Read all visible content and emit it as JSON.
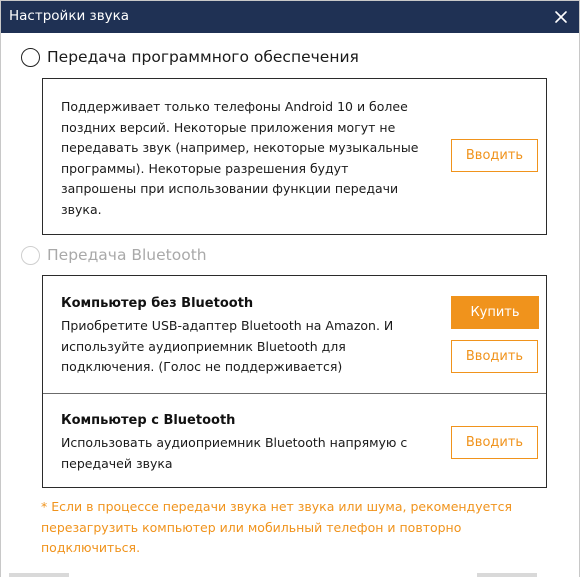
{
  "window": {
    "title": "Настройки звука",
    "close_icon": "close-icon"
  },
  "software_transfer": {
    "label": "Передача программного обеспечения",
    "selected": false,
    "description": "Поддерживает только телефоны Android 10 и более поздних версий. Некоторые приложения могут не передавать звук (например, некоторые музыкальные программы). Некоторые разрешения будут запрошены при использовании функции передачи звука.",
    "enter_label": "Вводить"
  },
  "bluetooth_transfer": {
    "label": "Передача Bluetooth",
    "disabled": true,
    "no_bt": {
      "title": "Компьютер без Bluetooth",
      "description": "Приобретите USB-адаптер Bluetooth на Amazon. И используйте аудиоприемник Bluetooth для подключения. (Голос не поддерживается)",
      "buy_label": "Купить",
      "enter_label": "Вводить"
    },
    "with_bt": {
      "title": "Компьютер с Bluetooth",
      "description": "Использовать аудиоприемник Bluetooth напрямую с передачей звука",
      "enter_label": "Вводить"
    }
  },
  "note": "* Если в процессе передачи звука нет звука или шума, рекомендуется перезагрузить компьютер или мобильный телефон и повторно подключиться.",
  "colors": {
    "titlebar": "#1f3154",
    "accent": "#f0931c",
    "disabled_text": "#a9a9a9"
  }
}
